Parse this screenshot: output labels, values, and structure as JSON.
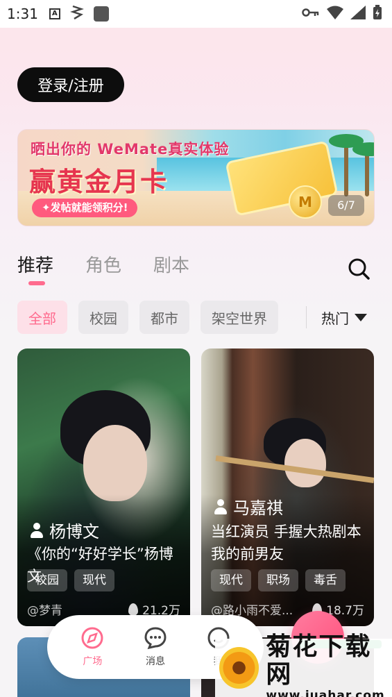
{
  "status_bar": {
    "time": "1:31",
    "keyboard_badge": "A"
  },
  "login_button": "登录/注册",
  "banner": {
    "line1": "晒出你的 WeMate真实体验",
    "line2": "赢黄金月卡",
    "pill": "✦发帖就能领积分!",
    "coin_letter": "M",
    "pager": "6/7"
  },
  "tabs": [
    {
      "label": "推荐",
      "active": true
    },
    {
      "label": "角色",
      "active": false
    },
    {
      "label": "剧本",
      "active": false
    }
  ],
  "filters": [
    {
      "label": "全部",
      "active": true
    },
    {
      "label": "校园",
      "active": false
    },
    {
      "label": "都市",
      "active": false
    },
    {
      "label": "架空世界",
      "active": false
    }
  ],
  "sort": {
    "label": "热门"
  },
  "cards": [
    {
      "name": "杨博文",
      "desc": "《你的“好好学长”杨博文",
      "tags": [
        "校园",
        "现代"
      ],
      "author": "@梦青",
      "heat": "21.2万"
    },
    {
      "name": "马嘉祺",
      "desc": "当红演员 手握大热剧本 我的前男友",
      "tags": [
        "现代",
        "职场",
        "毒舌"
      ],
      "author": "@路小雨不爱...",
      "heat": "18.7万"
    }
  ],
  "bottom_nav": [
    {
      "label": "广场",
      "active": true
    },
    {
      "label": "消息",
      "active": false
    },
    {
      "label": "我",
      "active": false
    }
  ],
  "watermark": {
    "title": "菊花下载网",
    "url": "www.juahar.com"
  },
  "colors": {
    "accent": "#ff6b8e",
    "login_bg": "#0d0d0d",
    "chip_active_bg": "#fde0e8"
  }
}
